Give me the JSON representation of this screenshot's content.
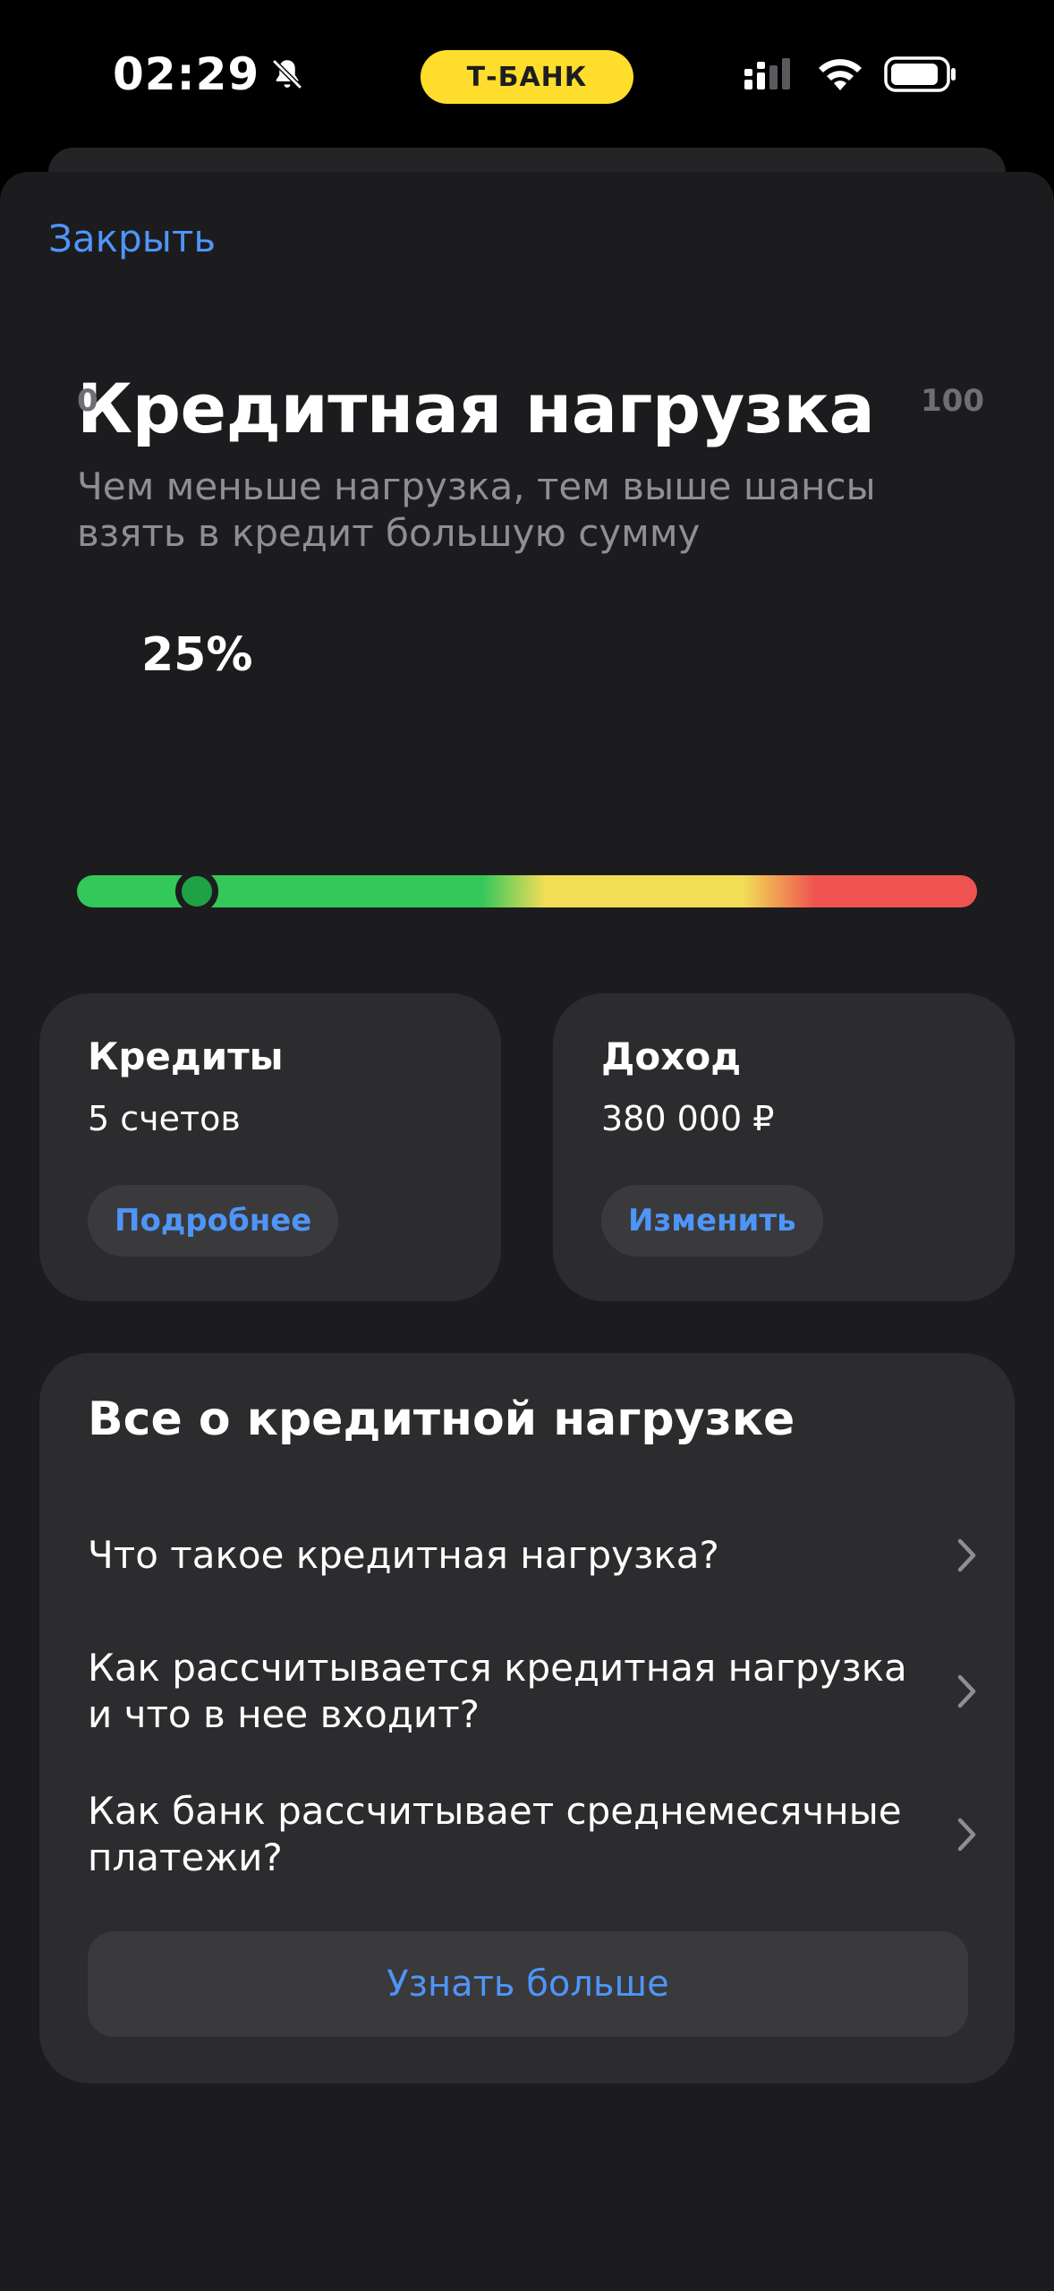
{
  "status_bar": {
    "time": "02:29",
    "bank_name": "Т-БАНК",
    "icons": [
      "bell-slash-icon",
      "signal-icon",
      "wifi-icon",
      "battery-icon"
    ]
  },
  "close_label": "Закрыть",
  "title": "Кредитная нагрузка",
  "subtitle": "Чем меньше нагрузка, тем выше шансы взять в кредит большую сумму",
  "gauge": {
    "min_label": "0",
    "max_label": "100",
    "value_label": "25%",
    "value": 25,
    "colors": [
      "#34c759",
      "#f2dd57",
      "#ef5350"
    ]
  },
  "cards": [
    {
      "title": "Кредиты",
      "value": "5 счетов",
      "button": "Подробнее"
    },
    {
      "title": "Доход",
      "value": "380 000 ₽",
      "button": "Изменить"
    }
  ],
  "info": {
    "title": "Все о кредитной нагрузке",
    "items": [
      "Что такое кредитная нагрузка?",
      "Как рассчитывается кредитная нагрузка и что в нее входит?",
      "Как банк рассчитывает среднемесячные платежи?"
    ],
    "more_button": "Узнать больше"
  },
  "colors": {
    "accent": "#4f95f8",
    "brand_yellow": "#ffdd2d",
    "background": "#1c1c1e",
    "card": "#2c2c2e"
  }
}
